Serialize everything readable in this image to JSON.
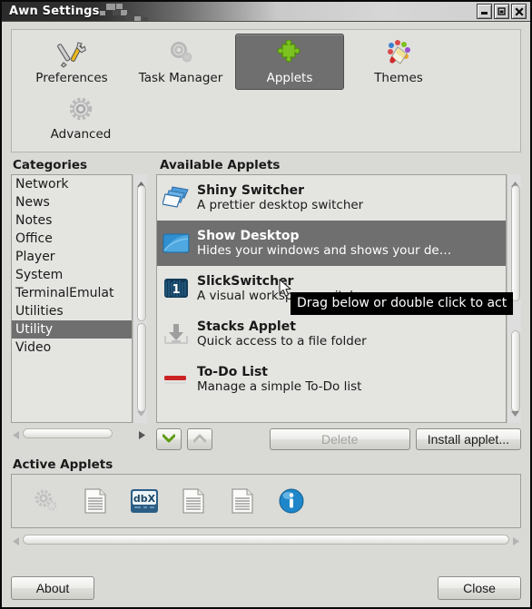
{
  "window": {
    "title": "Awn Settings",
    "buttons": [
      {
        "name": "minimize-button",
        "glyph": "minimize"
      },
      {
        "name": "maximize-button",
        "glyph": "maximize"
      },
      {
        "name": "close-button",
        "glyph": "close"
      }
    ]
  },
  "toolbar": {
    "items": [
      {
        "label": "Preferences",
        "icon": "tools-icon",
        "active": false
      },
      {
        "label": "Task Manager",
        "icon": "gears-icon",
        "active": false
      },
      {
        "label": "Applets",
        "icon": "puzzle-piece-icon",
        "active": true
      },
      {
        "label": "Themes",
        "icon": "paint-bucket-icon",
        "active": false
      },
      {
        "label": "Advanced",
        "icon": "gear-icon",
        "active": false
      }
    ]
  },
  "categories": {
    "title": "Categories",
    "items": [
      {
        "label": "Network",
        "selected": false
      },
      {
        "label": "News",
        "selected": false
      },
      {
        "label": "Notes",
        "selected": false
      },
      {
        "label": "Office",
        "selected": false
      },
      {
        "label": "Player",
        "selected": false
      },
      {
        "label": "System",
        "selected": false
      },
      {
        "label": "TerminalEmulat",
        "selected": false
      },
      {
        "label": "Utilities",
        "selected": false
      },
      {
        "label": "Utility",
        "selected": true
      },
      {
        "label": "Video",
        "selected": false
      }
    ]
  },
  "available_applets": {
    "title": "Available Applets",
    "items": [
      {
        "name": "Shiny Switcher",
        "description": "A prettier desktop switcher",
        "icon": "windows-stack-icon",
        "selected": false
      },
      {
        "name": "Show Desktop",
        "description": "Hides your windows and shows your de…",
        "icon": "desktop-icon",
        "selected": true
      },
      {
        "name": "SlickSwitcher",
        "description": "A visual workspace switcher",
        "icon": "workspace-one-icon",
        "selected": false
      },
      {
        "name": "Stacks Applet",
        "description": "Quick access to a file folder",
        "icon": "download-tray-icon",
        "selected": false
      },
      {
        "name": "To-Do List",
        "description": "Manage a simple To-Do list",
        "icon": "red-bar-icon",
        "selected": false
      }
    ]
  },
  "list_buttons": {
    "move_down": {
      "name": "move-down-button",
      "icon": "chevron-down-icon",
      "enabled": true
    },
    "move_up": {
      "name": "move-up-button",
      "icon": "chevron-up-icon",
      "enabled": false
    },
    "delete_label": "Delete",
    "delete_enabled": false,
    "install_label": "Install applet..."
  },
  "active_applets": {
    "title": "Active Applets",
    "items": [
      {
        "icon": "gears-icon"
      },
      {
        "icon": "document-icon"
      },
      {
        "icon": "dbx-icon"
      },
      {
        "icon": "document-icon"
      },
      {
        "icon": "document-icon"
      },
      {
        "icon": "info-icon"
      }
    ]
  },
  "tooltip": {
    "text": "Drag below or double click to act"
  },
  "footer": {
    "about_label": "About",
    "close_label": "Close"
  },
  "colors": {
    "selection": "#6f6f6f",
    "window_bg": "#d9d9d6",
    "list_bg": "#e4e4e1",
    "accent_green": "#6aa818",
    "accent_blue": "#2a8fd4"
  }
}
